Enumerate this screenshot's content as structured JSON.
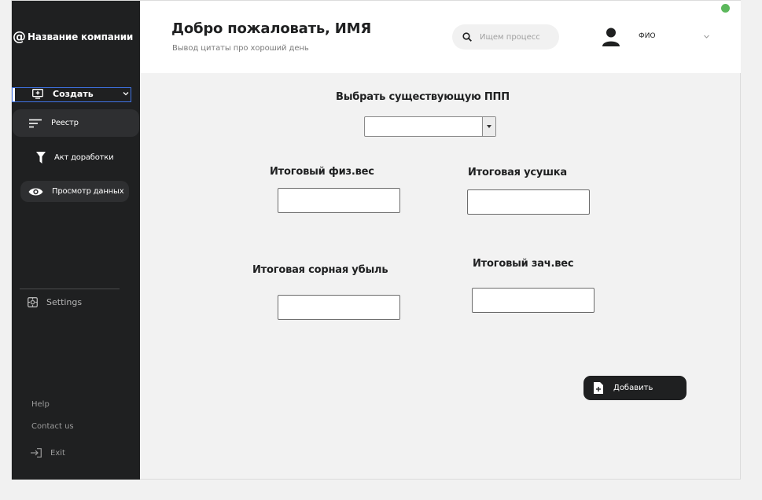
{
  "brand": {
    "at_symbol": "@",
    "company_name": "Название компании"
  },
  "sidebar": {
    "create_label": "Создать",
    "items": [
      {
        "label": "Реестр",
        "icon": "sort-lines-icon"
      },
      {
        "label": "Акт доработки",
        "icon": "filter-funnel-icon"
      },
      {
        "label": "Просмотр данных",
        "icon": "eye-icon"
      }
    ],
    "settings_label": "Settings",
    "help_label": "Help",
    "contact_label": "Contact us",
    "exit_label": "Exit"
  },
  "header": {
    "title": "Добро пожаловать, ИМЯ",
    "subtitle": "Вывод цитаты про хороший день",
    "search_placeholder": "Ищем процесс",
    "user_name": "ФИО"
  },
  "form": {
    "select_label": "Выбрать существующую ППП",
    "fields": [
      {
        "label": "Итоговый физ.вес"
      },
      {
        "label": "Итоговая усушка"
      },
      {
        "label": "Итоговая сорная убыль"
      },
      {
        "label": "Итоговый зач.вес"
      }
    ],
    "add_label": "Добавить"
  },
  "colors": {
    "sidebar_bg": "#1f2021",
    "accent_border": "#3f73e6",
    "status_online": "#5cb85c"
  }
}
